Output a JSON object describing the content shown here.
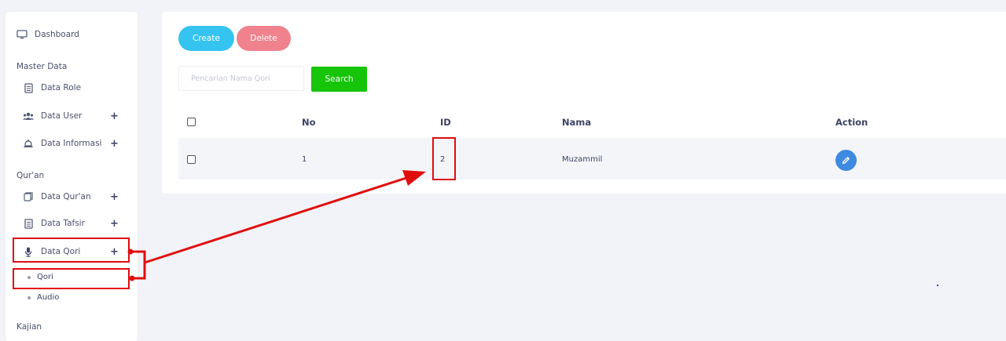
{
  "sidebar": {
    "dashboard": "Dashboard",
    "section_master": "Master Data",
    "data_role": "Data Role",
    "data_user": "Data User",
    "data_informasi": "Data Informasi",
    "section_quran": "Qur'an",
    "data_quran": "Data Qur'an",
    "data_tafsir": "Data Tafsir",
    "data_qori": "Data Qori",
    "sub_qori": "Qori",
    "sub_audio": "Audio",
    "section_kajian": "Kajian",
    "expand_symbol": "+"
  },
  "toolbar": {
    "create_label": "Create",
    "delete_label": "Delete",
    "search_placeholder": "Pencarian Nama Qori",
    "search_label": "Search"
  },
  "table": {
    "headers": [
      "No",
      "ID",
      "Nama",
      "Action"
    ],
    "rows": [
      {
        "no": "1",
        "id": "2",
        "nama": "Muzammil"
      }
    ]
  },
  "colors": {
    "create": "#35c3f0",
    "delete": "#f0828d",
    "search": "#16c40a",
    "edit": "#3f8ae0",
    "annotation": "#e00d0d"
  },
  "icons": [
    "monitor-icon",
    "document-icon",
    "users-icon",
    "bell-icon",
    "book-icon",
    "document-icon",
    "microphone-icon",
    "pencil-icon"
  ]
}
